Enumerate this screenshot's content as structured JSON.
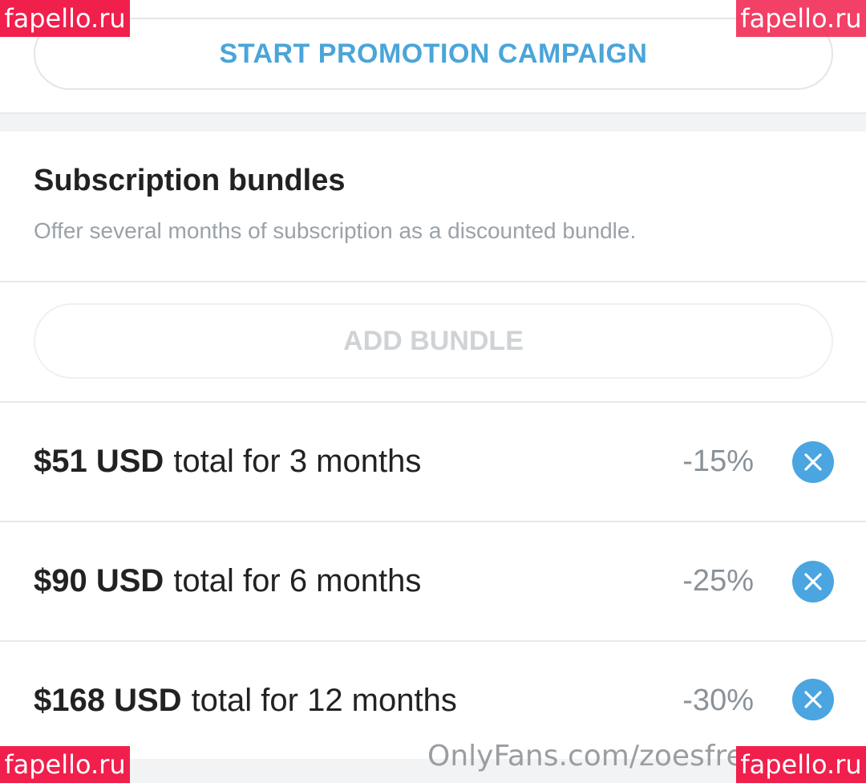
{
  "promotion": {
    "button_label": "START PROMOTION CAMPAIGN"
  },
  "bundles": {
    "title": "Subscription bundles",
    "description": "Offer several months of subscription as a discounted bundle.",
    "add_button_label": "ADD BUNDLE",
    "items": [
      {
        "price": "$51 USD",
        "suffix": "total for 3 months",
        "discount": "-15%"
      },
      {
        "price": "$90 USD",
        "suffix": "total for 6 months",
        "discount": "-25%"
      },
      {
        "price": "$168 USD",
        "suffix": "total for 12 months",
        "discount": "-30%"
      }
    ],
    "remove_icon": "close-icon"
  },
  "watermarks": {
    "tag_text": "fapello.ru",
    "onlyfans_text": "OnlyFans.com/zoesfrer"
  },
  "colors": {
    "accent": "#4aa5d9",
    "remove_button": "#4aa5e0",
    "watermark_tag": "#f01f4c",
    "muted_text": "#9aa2a9",
    "disabled_text": "#cfd3d6"
  }
}
